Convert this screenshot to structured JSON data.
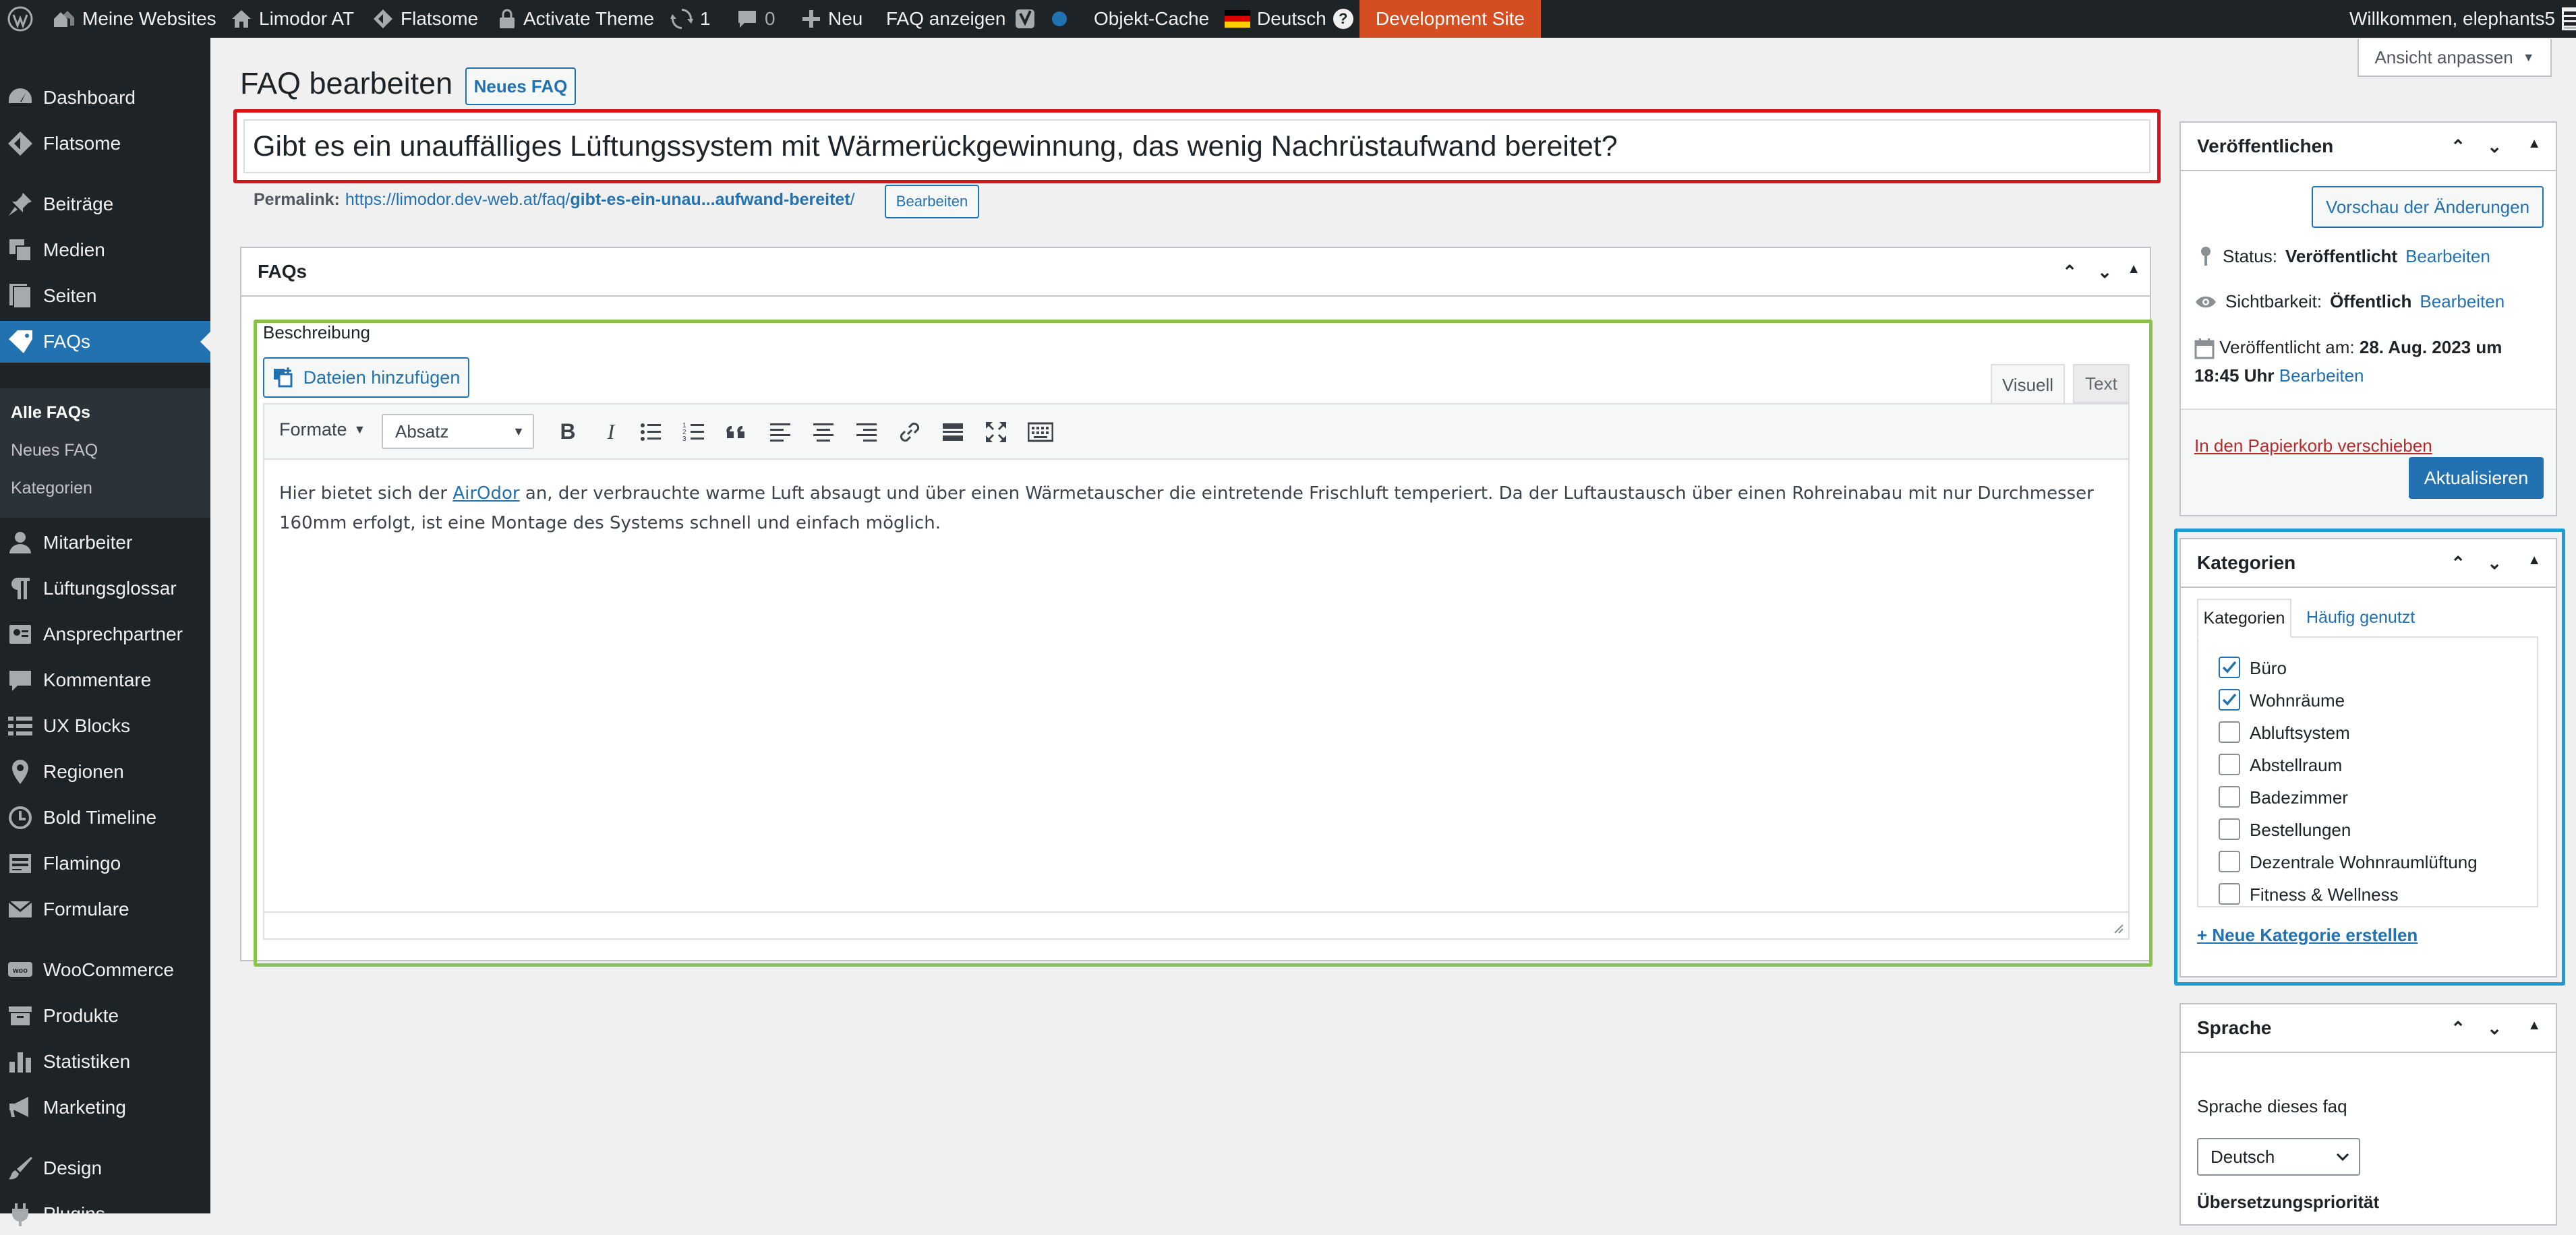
{
  "adminbar": {
    "my_sites": "Meine Websites",
    "site_name": "Limodor AT",
    "flatsome": "Flatsome",
    "activate_theme": "Activate Theme",
    "updates_count": "1",
    "comments_count": "0",
    "new": "Neu",
    "view_faq": "FAQ anzeigen",
    "object_cache": "Objekt-Cache",
    "language": "Deutsch",
    "dev_site": "Development Site",
    "greeting": "Willkommen, elephants5"
  },
  "sidebar": {
    "items": [
      {
        "label": "Dashboard",
        "icon": "dashboard-icon"
      },
      {
        "label": "Flatsome",
        "icon": "flatsome-icon"
      },
      {
        "label": "Beiträge",
        "icon": "pin-icon"
      },
      {
        "label": "Medien",
        "icon": "media-icon"
      },
      {
        "label": "Seiten",
        "icon": "pages-icon"
      },
      {
        "label": "FAQs",
        "icon": "faq-icon"
      },
      {
        "label": "Mitarbeiter",
        "icon": "users-icon"
      },
      {
        "label": "Lüftungsglossar",
        "icon": "paragraph-icon"
      },
      {
        "label": "Ansprechpartner",
        "icon": "contact-icon"
      },
      {
        "label": "Kommentare",
        "icon": "comment-icon"
      },
      {
        "label": "UX Blocks",
        "icon": "blocks-icon"
      },
      {
        "label": "Regionen",
        "icon": "location-icon"
      },
      {
        "label": "Bold Timeline",
        "icon": "clock-icon"
      },
      {
        "label": "Flamingo",
        "icon": "flamingo-icon"
      },
      {
        "label": "Formulare",
        "icon": "mail-icon"
      },
      {
        "label": "WooCommerce",
        "icon": "woo-icon"
      },
      {
        "label": "Produkte",
        "icon": "archive-icon"
      },
      {
        "label": "Statistiken",
        "icon": "chart-icon"
      },
      {
        "label": "Marketing",
        "icon": "megaphone-icon"
      },
      {
        "label": "Design",
        "icon": "brush-icon"
      },
      {
        "label": "Plugins",
        "icon": "plugin-icon"
      }
    ],
    "submenu": [
      "Alle FAQs",
      "Neues FAQ",
      "Kategorien"
    ]
  },
  "page": {
    "title": "FAQ bearbeiten",
    "new_button": "Neues FAQ",
    "screen_options": "Ansicht anpassen",
    "post_title": "Gibt es ein unauffälliges Lüftungssystem mit Wärmerückgewinnung, das wenig Nachrüstaufwand bereitet?",
    "permalink_label": "Permalink:",
    "permalink_base": "https://limodor.dev-web.at/faq/",
    "permalink_slug": "gibt-es-ein-unau...aufwand-bereitet",
    "permalink_end": "/",
    "permalink_edit": "Bearbeiten"
  },
  "faq_box": {
    "title": "FAQs",
    "field_label": "Beschreibung",
    "add_media": "Dateien hinzufügen",
    "tab_visual": "Visuell",
    "tab_text": "Text",
    "formats": "Formate",
    "paragraph_select": "Absatz",
    "content_before": "Hier bietet sich der ",
    "content_link": "AirOdor",
    "content_after": " an, der verbrauchte warme Luft absaugt und über einen Wärmetauscher die eintretende Frischluft temperiert. Da der Luftaustausch über einen Rohreinabau mit nur Durchmesser 160mm erfolgt, ist eine Montage des Systems schnell und einfach möglich."
  },
  "publish": {
    "title": "Veröffentlichen",
    "preview": "Vorschau der Änderungen",
    "status_label": "Status:",
    "status_value": "Veröffentlicht",
    "visibility_label": "Sichtbarkeit:",
    "visibility_value": "Öffentlich",
    "published_label": "Veröffentlicht am:",
    "published_value": "28. Aug. 2023 um",
    "published_time": "18:45 Uhr",
    "edit": "Bearbeiten",
    "trash": "In den Papierkorb verschieben",
    "update": "Aktualisieren"
  },
  "categories": {
    "title": "Kategorien",
    "tab_all": "Kategorien",
    "tab_popular": "Häufig genutzt",
    "items": [
      {
        "label": "Büro",
        "checked": true
      },
      {
        "label": "Wohnräume",
        "checked": true
      },
      {
        "label": "Abluftsystem",
        "checked": false
      },
      {
        "label": "Abstellraum",
        "checked": false
      },
      {
        "label": "Badezimmer",
        "checked": false
      },
      {
        "label": "Bestellungen",
        "checked": false
      },
      {
        "label": "Dezentrale Wohnraumlüftung",
        "checked": false
      },
      {
        "label": "Fitness & Wellness",
        "checked": false
      }
    ],
    "add_new": "+ Neue Kategorie erstellen"
  },
  "language_box": {
    "title": "Sprache",
    "label": "Sprache dieses faq",
    "value": "Deutsch",
    "priority_label": "Übersetzungspriorität"
  },
  "colors": {
    "accent": "#2271b1",
    "dev": "#d54e21",
    "title_highlight": "#d6141c",
    "editor_highlight": "#8bc34a",
    "categories_highlight": "#1e9bd7"
  }
}
